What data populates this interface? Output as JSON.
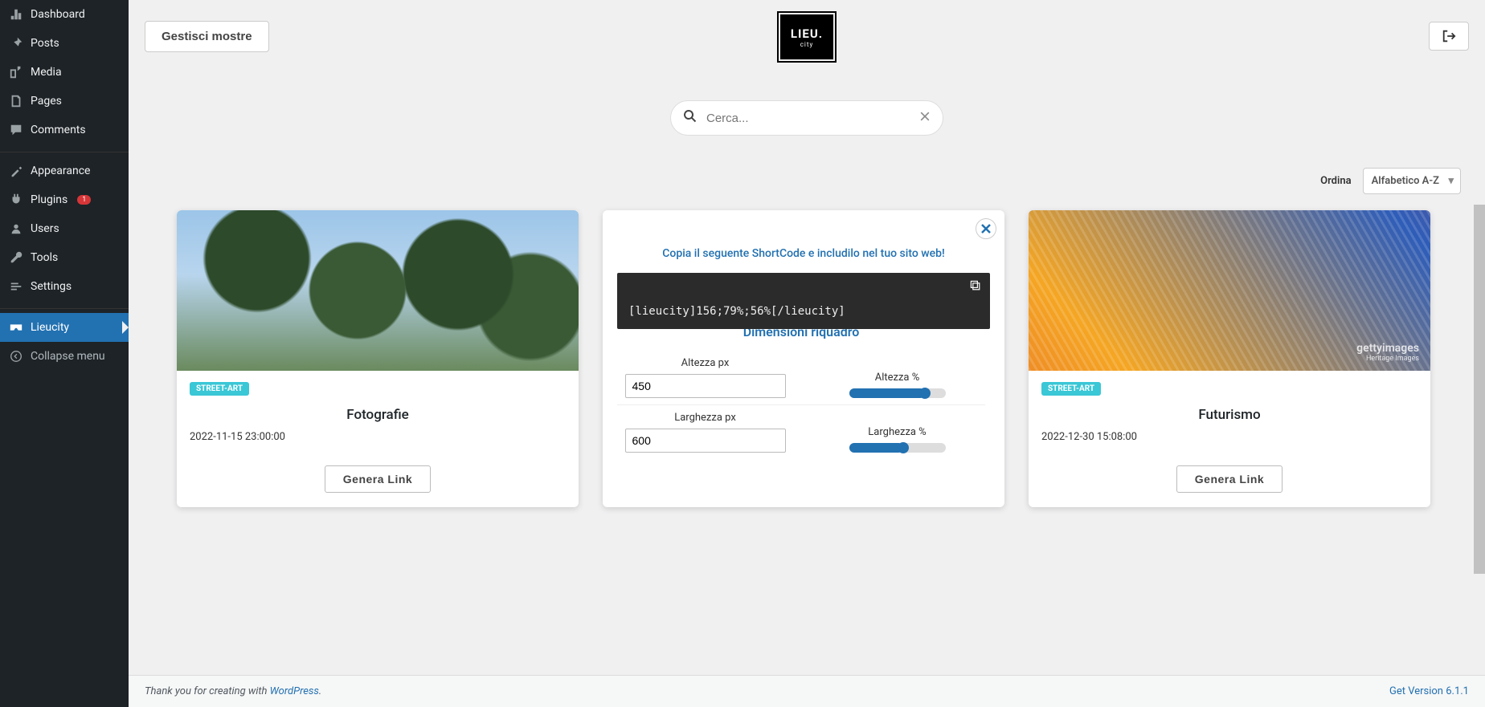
{
  "sidebar": {
    "items": [
      {
        "label": "Dashboard"
      },
      {
        "label": "Posts"
      },
      {
        "label": "Media"
      },
      {
        "label": "Pages"
      },
      {
        "label": "Comments"
      },
      {
        "label": "Appearance"
      },
      {
        "label": "Plugins",
        "badge": "1"
      },
      {
        "label": "Users"
      },
      {
        "label": "Tools"
      },
      {
        "label": "Settings"
      },
      {
        "label": "Lieucity"
      },
      {
        "label": "Collapse menu"
      }
    ]
  },
  "topbar": {
    "manage_button": "Gestisci mostre",
    "logo_main": "LIEU.",
    "logo_sub": "city"
  },
  "search": {
    "placeholder": "Cerca..."
  },
  "sort": {
    "label": "Ordina",
    "selected": "Alfabetico A-Z"
  },
  "cards": [
    {
      "tag": "STREET-ART",
      "title": "Fotografie",
      "date": "2022-11-15 23:00:00",
      "button": "Genera Link"
    },
    {
      "tag": "STREET-ART",
      "title": "Futurismo",
      "date": "2022-12-30 15:08:00",
      "button": "Genera Link",
      "watermark_main": "gettyimages",
      "watermark_sub": "Heritage Images"
    }
  ],
  "modal": {
    "hint": "Copia il seguente ShortCode e includilo nel tuo sito web!",
    "shortcode": "[lieucity]156;79%;56%[/lieucity]",
    "dim_title": "Dimensioni riquadro",
    "altezza_px_label": "Altezza px",
    "altezza_px_value": "450",
    "altezza_pct_label": "Altezza %",
    "altezza_pct_value": 79,
    "larghezza_px_label": "Larghezza px",
    "larghezza_px_value": "600",
    "larghezza_pct_label": "Larghezza %",
    "larghezza_pct_value": 56
  },
  "footer": {
    "thanks_prefix": "Thank you for creating with ",
    "thanks_link": "WordPress",
    "thanks_suffix": ".",
    "version": "Get Version 6.1.1"
  }
}
